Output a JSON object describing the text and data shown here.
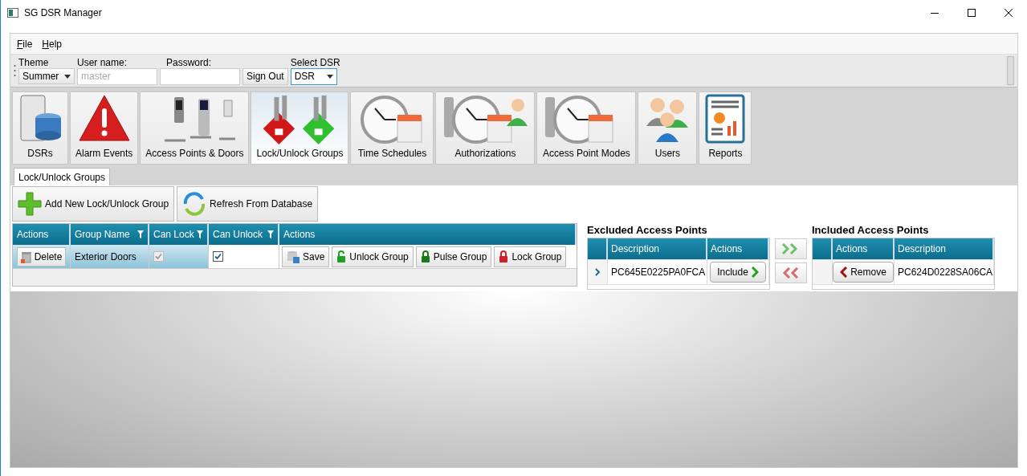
{
  "window": {
    "title": "SG DSR Manager"
  },
  "menu": [
    "File",
    "Help"
  ],
  "toolbar": {
    "theme": {
      "label": "Theme",
      "value": "Summer"
    },
    "username": {
      "label": "User name:",
      "placeholder": "master"
    },
    "password": {
      "label": "Password:"
    },
    "sign_out": "Sign Out",
    "select_dsr": {
      "label": "Select DSR",
      "value": "DSR"
    }
  },
  "ribbon": [
    {
      "label": "DSRs",
      "selected": false
    },
    {
      "label": "Alarm Events",
      "selected": false
    },
    {
      "label": "Access Points & Doors",
      "selected": false
    },
    {
      "label": "Lock/Unlock Groups",
      "selected": true
    },
    {
      "label": "Time Schedules",
      "selected": false
    },
    {
      "label": "Authorizations",
      "selected": false
    },
    {
      "label": "Access Point Modes",
      "selected": false
    },
    {
      "label": "Users",
      "selected": false
    },
    {
      "label": "Reports",
      "selected": false
    }
  ],
  "content_tab": {
    "label": "Lock/Unlock Groups",
    "selected": true
  },
  "buttons": [
    "Add New Lock/Unlock Group",
    "Refresh From Database"
  ],
  "groups_table": {
    "columns": [
      {
        "label": "Actions",
        "filterable": false
      },
      {
        "label": "Group Name",
        "filterable": true
      },
      {
        "label": "Can Lock",
        "filterable": true
      },
      {
        "label": "Can Unlock",
        "filterable": true
      },
      {
        "label": "Actions",
        "filterable": false
      }
    ],
    "rows": [
      {
        "selected": true,
        "delete": "Delete",
        "group_name": "Exterior Doors",
        "can_lock": {
          "checked": true,
          "disabled": true
        },
        "can_unlock": {
          "checked": true,
          "disabled": false
        },
        "actions": [
          {
            "kind": "save",
            "label": "Save"
          },
          {
            "kind": "unlock",
            "label": "Unlock Group"
          },
          {
            "kind": "pulse",
            "label": "Pulse Group"
          },
          {
            "kind": "lock",
            "label": "Lock Group"
          }
        ]
      }
    ]
  },
  "excluded": {
    "title": "Excluded Access Points",
    "columns": [
      "Description",
      "Actions"
    ],
    "rows": [
      {
        "current": true,
        "description": "PC645E0225PA0FCA",
        "action": "Include"
      }
    ]
  },
  "included": {
    "title": "Included Access Points",
    "columns": [
      "Actions",
      "Description"
    ],
    "rows": [
      {
        "current": false,
        "action": "Remove",
        "description": "PC624D0228SA06CA"
      }
    ]
  }
}
